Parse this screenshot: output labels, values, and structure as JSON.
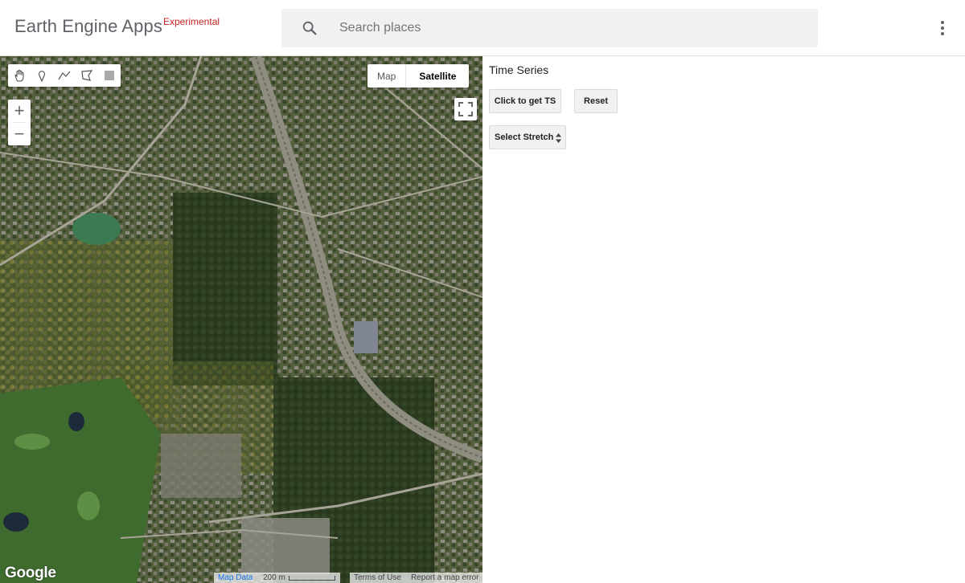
{
  "header": {
    "app_title": "Earth Engine Apps",
    "badge": "Experimental",
    "search_placeholder": "Search places",
    "search_icon": "search-icon",
    "menu_icon": "more-vert-icon"
  },
  "map": {
    "drawing_tools": [
      {
        "name": "pan-hand-icon"
      },
      {
        "name": "point-marker-icon"
      },
      {
        "name": "line-icon"
      },
      {
        "name": "polygon-icon"
      },
      {
        "name": "rectangle-icon"
      }
    ],
    "map_type": {
      "options": [
        "Map",
        "Satellite"
      ],
      "selected": "Satellite"
    },
    "zoom_in_label": "+",
    "zoom_out_label": "−",
    "google_logo": "Google",
    "attribution": {
      "map_data": "Map Data",
      "scale": "200 m",
      "terms": "Terms of Use",
      "report": "Report a map error"
    },
    "colors": {
      "forest": "#2f3f22",
      "residential": "#5d6b4b",
      "road": "#9a9a8e",
      "golf": "#3f6b2e"
    }
  },
  "panel": {
    "title": "Time Series",
    "button_ts": "Click to get TS",
    "button_reset": "Reset",
    "select_stretch": "Select Stretch"
  }
}
